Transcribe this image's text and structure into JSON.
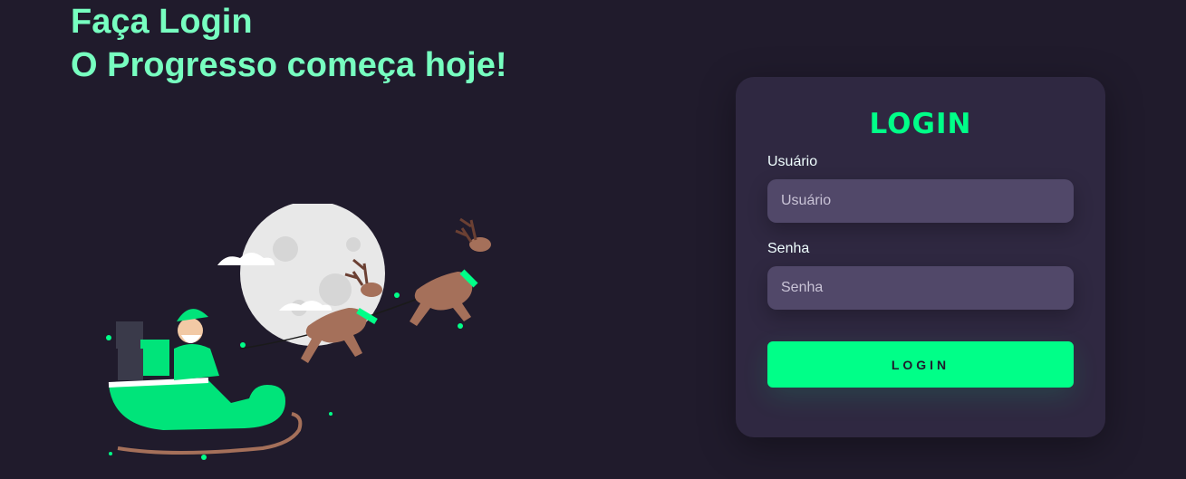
{
  "headline": {
    "line1": "Faça Login",
    "line2": "O Progresso começa hoje!"
  },
  "illustration": {
    "icon": "santa-sleigh-reindeer-illustration"
  },
  "login_card": {
    "title": "LOGIN",
    "username": {
      "label": "Usuário",
      "placeholder": "Usuário",
      "value": ""
    },
    "password": {
      "label": "Senha",
      "placeholder": "Senha",
      "value": ""
    },
    "submit_label": "LOGIN"
  },
  "colors": {
    "background": "#201b2c",
    "card": "#2f2841",
    "input": "#514869",
    "accent": "#00ff88",
    "headline": "#77ffc0"
  }
}
